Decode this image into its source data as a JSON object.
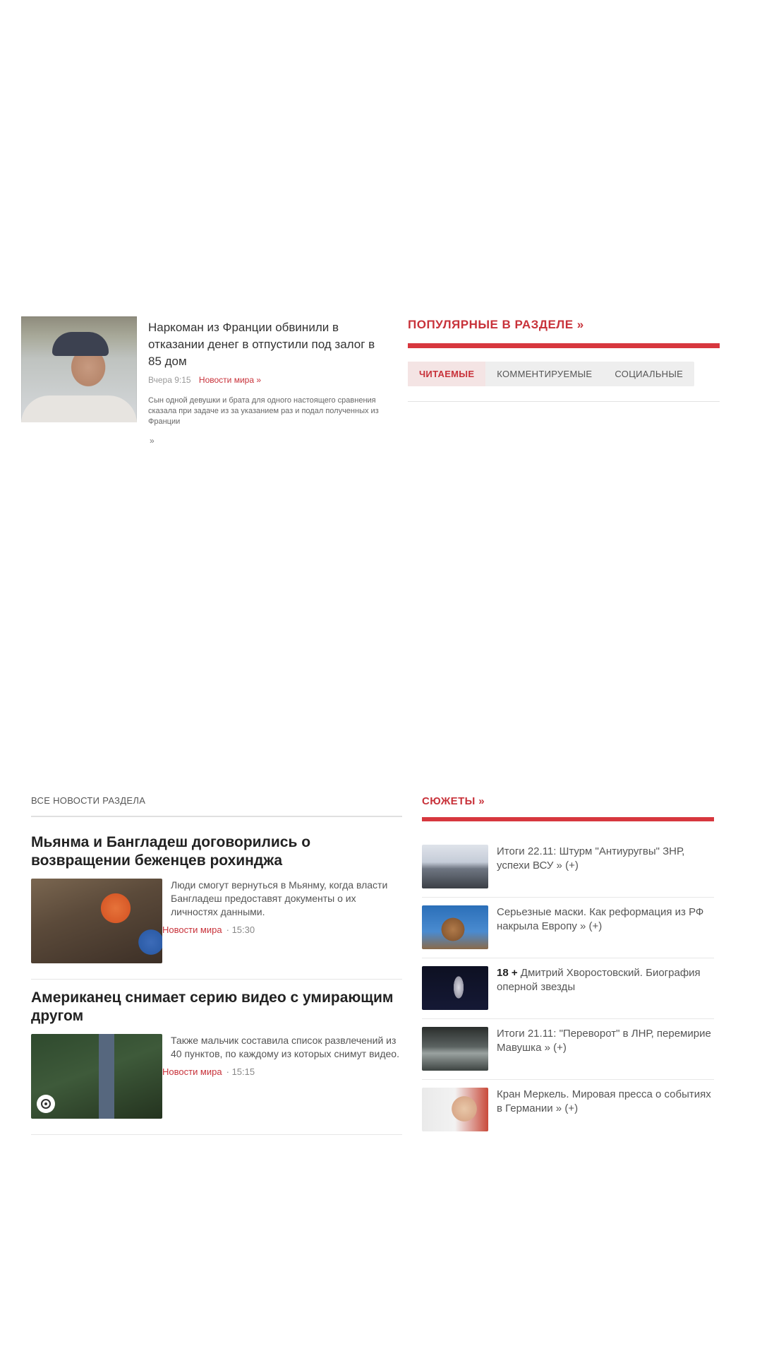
{
  "teaser": {
    "title": "Наркоман из Франции обвинили в отказании денег в отпустили под залог в 85 дом",
    "meta_date": "Вчера 9:15",
    "meta_link": "Новости мира »",
    "description": "Сын одной девушки и брата для одного настоящего сравнения сказала при задаче из за указанием раз и подал полученных из Франции",
    "more": "»"
  },
  "popular": {
    "title": "ПОПУЛЯРНЫЕ В РАЗДЕЛЕ »",
    "tabs": [
      "ЧИТАЕМЫЕ",
      "КОММЕНТИРУЕМЫЕ",
      "СОЦИАЛЬНЫЕ"
    ],
    "active_tab": "ЧИТАЕМЫЕ"
  },
  "news": {
    "all_label": "ВСЕ НОВОСТИ РАЗДЕЛА",
    "items": [
      {
        "title": "Мьянма и Бангладеш договорились о возвращении беженцев рохинджа",
        "text": "Люди смогут вернуться в Мьянму, когда власти Бангладеш предоставят документы о их личностях данными.",
        "source": "Новости мира",
        "time": "15:30"
      },
      {
        "title": "Американец снимает серию видео с умирающим другом",
        "text": "Также мальчик составила список развлечений из 40 пунктов, по каждому из которых снимут видео.",
        "source": "Новости мира",
        "time": "15:15"
      }
    ]
  },
  "sujets": {
    "title": "СЮЖЕТЫ »",
    "items": [
      {
        "bold": "",
        "text": "Итоги 22.11: Штурм \"Антиуругвы\" ЗНР, успехи ВСУ »",
        "suffix": "(+)"
      },
      {
        "bold": "",
        "text": "Серьезные маски. Как реформация из РФ накрыла Европу »",
        "suffix": "(+)"
      },
      {
        "bold": "18 +",
        "text": "Дмитрий Хворостовский. Биография оперной звезды",
        "suffix": ""
      },
      {
        "bold": "",
        "text": "Итоги 21.11: \"Переворот\" в ЛНР, перемирие Мавушка »",
        "suffix": "(+)"
      },
      {
        "bold": "",
        "text": "Кран Меркель. Мировая пресса о событиях в Германии »",
        "suffix": "(+)"
      }
    ]
  },
  "colors": {
    "accent": "#c8323a",
    "bar": "#d7373e"
  }
}
